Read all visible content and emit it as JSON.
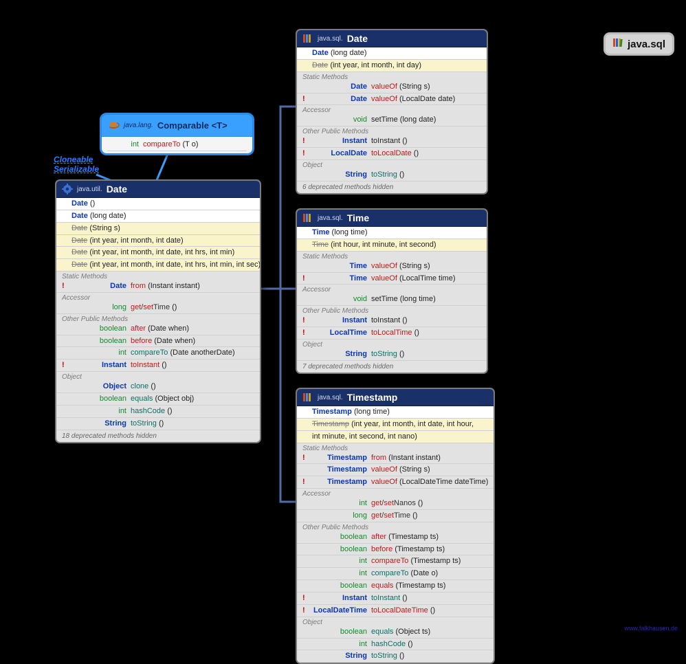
{
  "package_badge": "java.sql",
  "site_url": "www.falkhausen.de",
  "interfaces": {
    "l1": "Cloneable",
    "l2": "Serializable"
  },
  "comparable": {
    "pkg": "java.lang.",
    "name": "Comparable",
    "type_param": "<T>",
    "method": {
      "marker": "",
      "ret": "int",
      "name": "compareTo",
      "params": "(T o)",
      "ret_cls": "c-green",
      "name_cls": "c-red"
    }
  },
  "cards": {
    "util_date": {
      "pkg": "java.util.",
      "name": "Date",
      "ctors": [
        {
          "name": "Date",
          "params": "()",
          "cls": "ctor-new",
          "label_cls": "c-blue"
        },
        {
          "name": "Date",
          "params": "(long date)",
          "cls": "ctor-new",
          "label_cls": "c-blue"
        },
        {
          "name": "Date",
          "params": "(String s)",
          "cls": "ctor-old",
          "label_cls": "c-gray strike"
        },
        {
          "name": "Date",
          "params": "(int year, int month, int date)",
          "cls": "ctor-old",
          "label_cls": "c-gray strike"
        },
        {
          "name": "Date",
          "params": "(int year, int month, int date, int hrs, int min)",
          "cls": "ctor-old",
          "label_cls": "c-gray strike"
        },
        {
          "name": "Date",
          "params": "(int year, int month, int date, int hrs, int min, int sec)",
          "cls": "ctor-old",
          "label_cls": "c-gray strike"
        }
      ],
      "sections": [
        {
          "title": "Static Methods",
          "rows": [
            {
              "marker": "!",
              "ret": "Date",
              "ret_cls": "c-blue",
              "name": "from",
              "name_cls": "c-red",
              "params": "(Instant instant)"
            }
          ]
        },
        {
          "title": "Accessor",
          "rows": [
            {
              "marker": "",
              "ret": "long",
              "ret_cls": "c-green",
              "name": "get/setTime",
              "name_cls": "c-black",
              "params": "()",
              "name_html": "<span class='c-red'>get</span>/<span class='c-red'>set</span>Time"
            }
          ]
        },
        {
          "title": "Other Public Methods",
          "rows": [
            {
              "marker": "",
              "ret": "boolean",
              "ret_cls": "c-green",
              "name": "after",
              "name_cls": "c-red",
              "params": "(Date when)"
            },
            {
              "marker": "",
              "ret": "boolean",
              "ret_cls": "c-green",
              "name": "before",
              "name_cls": "c-red",
              "params": "(Date when)"
            },
            {
              "marker": "",
              "ret": "int",
              "ret_cls": "c-green",
              "name": "compareTo",
              "name_cls": "c-teal",
              "params": "(Date anotherDate)"
            },
            {
              "marker": "!",
              "ret": "Instant",
              "ret_cls": "c-blue",
              "name": "toInstant",
              "name_cls": "c-red",
              "params": "()"
            }
          ]
        },
        {
          "title": "Object",
          "rows": [
            {
              "marker": "",
              "ret": "Object",
              "ret_cls": "c-blue",
              "name": "clone",
              "name_cls": "c-teal",
              "params": "()"
            },
            {
              "marker": "",
              "ret": "boolean",
              "ret_cls": "c-green",
              "name": "equals",
              "name_cls": "c-teal",
              "params": "(Object obj)"
            },
            {
              "marker": "",
              "ret": "int",
              "ret_cls": "c-green",
              "name": "hashCode",
              "name_cls": "c-teal",
              "params": "()"
            },
            {
              "marker": "",
              "ret": "String",
              "ret_cls": "c-blue",
              "name": "toString",
              "name_cls": "c-teal",
              "params": "()"
            }
          ]
        }
      ],
      "footnote": "18 deprecated methods hidden"
    },
    "sql_date": {
      "pkg": "java.sql.",
      "name": "Date",
      "ctors": [
        {
          "name": "Date",
          "params": "(long date)",
          "cls": "ctor-new",
          "label_cls": "c-blue"
        },
        {
          "name": "Date",
          "params": "(int year, int month, int day)",
          "cls": "ctor-old",
          "label_cls": "c-gray strike"
        }
      ],
      "sections": [
        {
          "title": "Static Methods",
          "rows": [
            {
              "marker": "",
              "ret": "Date",
              "ret_cls": "c-blue",
              "name": "valueOf",
              "name_cls": "c-red",
              "params": "(String s)"
            },
            {
              "marker": "!",
              "ret": "Date",
              "ret_cls": "c-blue",
              "name": "valueOf",
              "name_cls": "c-red",
              "params": "(LocalDate date)"
            }
          ]
        },
        {
          "title": "Accessor",
          "rows": [
            {
              "marker": "",
              "ret": "void",
              "ret_cls": "c-green",
              "name": "setTime",
              "name_cls": "c-black",
              "params": "(long date)"
            }
          ]
        },
        {
          "title": "Other Public Methods",
          "rows": [
            {
              "marker": "!",
              "ret": "Instant",
              "ret_cls": "c-blue",
              "name": "toInstant",
              "name_cls": "c-black",
              "params": "()"
            },
            {
              "marker": "!",
              "ret": "LocalDate",
              "ret_cls": "c-blue",
              "name": "toLocalDate",
              "name_cls": "c-red",
              "params": "()"
            }
          ]
        },
        {
          "title": "Object",
          "rows": [
            {
              "marker": "",
              "ret": "String",
              "ret_cls": "c-blue",
              "name": "toString",
              "name_cls": "c-teal",
              "params": "()"
            }
          ]
        }
      ],
      "footnote": "6 deprecated methods hidden"
    },
    "sql_time": {
      "pkg": "java.sql.",
      "name": "Time",
      "ctors": [
        {
          "name": "Time",
          "params": "(long time)",
          "cls": "ctor-new",
          "label_cls": "c-blue"
        },
        {
          "name": "Time",
          "params": "(int hour, int minute, int second)",
          "cls": "ctor-old",
          "label_cls": "c-gray strike"
        }
      ],
      "sections": [
        {
          "title": "Static Methods",
          "rows": [
            {
              "marker": "",
              "ret": "Time",
              "ret_cls": "c-blue",
              "name": "valueOf",
              "name_cls": "c-red",
              "params": "(String s)"
            },
            {
              "marker": "!",
              "ret": "Time",
              "ret_cls": "c-blue",
              "name": "valueOf",
              "name_cls": "c-red",
              "params": "(LocalTime time)"
            }
          ]
        },
        {
          "title": "Accessor",
          "rows": [
            {
              "marker": "",
              "ret": "void",
              "ret_cls": "c-green",
              "name": "setTime",
              "name_cls": "c-black",
              "params": "(long time)"
            }
          ]
        },
        {
          "title": "Other Public Methods",
          "rows": [
            {
              "marker": "!",
              "ret": "Instant",
              "ret_cls": "c-blue",
              "name": "toInstant",
              "name_cls": "c-black",
              "params": "()"
            },
            {
              "marker": "!",
              "ret": "LocalTime",
              "ret_cls": "c-blue",
              "name": "toLocalTime",
              "name_cls": "c-red",
              "params": "()"
            }
          ]
        },
        {
          "title": "Object",
          "rows": [
            {
              "marker": "",
              "ret": "String",
              "ret_cls": "c-blue",
              "name": "toString",
              "name_cls": "c-teal",
              "params": "()"
            }
          ]
        }
      ],
      "footnote": "7 deprecated methods hidden"
    },
    "sql_ts": {
      "pkg": "java.sql.",
      "name": "Timestamp",
      "ctors": [
        {
          "name": "Timestamp",
          "params": "(long time)",
          "cls": "ctor-new",
          "label_cls": "c-blue"
        },
        {
          "name": "Timestamp",
          "params": "(int year, int month, int date, int hour,",
          "cls": "ctor-old",
          "label_cls": "c-gray strike"
        },
        {
          "name": "",
          "params": "int minute, int second, int nano)",
          "cls": "ctor-old",
          "label_cls": "c-gray"
        }
      ],
      "sections": [
        {
          "title": "Static Methods",
          "rows": [
            {
              "marker": "!",
              "ret": "Timestamp",
              "ret_cls": "c-blue",
              "name": "from",
              "name_cls": "c-red",
              "params": "(Instant instant)"
            },
            {
              "marker": "",
              "ret": "Timestamp",
              "ret_cls": "c-blue",
              "name": "valueOf",
              "name_cls": "c-red",
              "params": "(String s)"
            },
            {
              "marker": "!",
              "ret": "Timestamp",
              "ret_cls": "c-blue",
              "name": "valueOf",
              "name_cls": "c-red",
              "params": "(LocalDateTime dateTime)"
            }
          ]
        },
        {
          "title": "Accessor",
          "rows": [
            {
              "marker": "",
              "ret": "int",
              "ret_cls": "c-green",
              "name": "",
              "name_cls": "c-black",
              "params": "()",
              "name_html": "<span class='c-red'>get</span>/<span class='c-red'>set</span>Nanos"
            },
            {
              "marker": "",
              "ret": "long",
              "ret_cls": "c-green",
              "name": "",
              "name_cls": "c-black",
              "params": "()",
              "name_html": "<span class='c-red'>get</span>/<span class='c-red'>set</span>Time"
            }
          ]
        },
        {
          "title": "Other Public Methods",
          "rows": [
            {
              "marker": "",
              "ret": "boolean",
              "ret_cls": "c-green",
              "name": "after",
              "name_cls": "c-red",
              "params": "(Timestamp ts)"
            },
            {
              "marker": "",
              "ret": "boolean",
              "ret_cls": "c-green",
              "name": "before",
              "name_cls": "c-red",
              "params": "(Timestamp ts)"
            },
            {
              "marker": "",
              "ret": "int",
              "ret_cls": "c-green",
              "name": "compareTo",
              "name_cls": "c-red",
              "params": "(Timestamp ts)"
            },
            {
              "marker": "",
              "ret": "int",
              "ret_cls": "c-green",
              "name": "compareTo",
              "name_cls": "c-teal",
              "params": "(Date o)"
            },
            {
              "marker": "",
              "ret": "boolean",
              "ret_cls": "c-green",
              "name": "equals",
              "name_cls": "c-red",
              "params": "(Timestamp ts)"
            },
            {
              "marker": "!",
              "ret": "Instant",
              "ret_cls": "c-blue",
              "name": "toInstant",
              "name_cls": "c-teal",
              "params": "()"
            },
            {
              "marker": "!",
              "ret": "LocalDateTime",
              "ret_cls": "c-blue",
              "name": "toLocalDateTime",
              "name_cls": "c-red",
              "params": "()"
            }
          ]
        },
        {
          "title": "Object",
          "rows": [
            {
              "marker": "",
              "ret": "boolean",
              "ret_cls": "c-green",
              "name": "equals",
              "name_cls": "c-teal",
              "params": "(Object ts)"
            },
            {
              "marker": "",
              "ret": "int",
              "ret_cls": "c-green",
              "name": "hashCode",
              "name_cls": "c-teal",
              "params": "()"
            },
            {
              "marker": "",
              "ret": "String",
              "ret_cls": "c-blue",
              "name": "toString",
              "name_cls": "c-teal",
              "params": "()"
            }
          ]
        }
      ],
      "footnote": ""
    }
  }
}
